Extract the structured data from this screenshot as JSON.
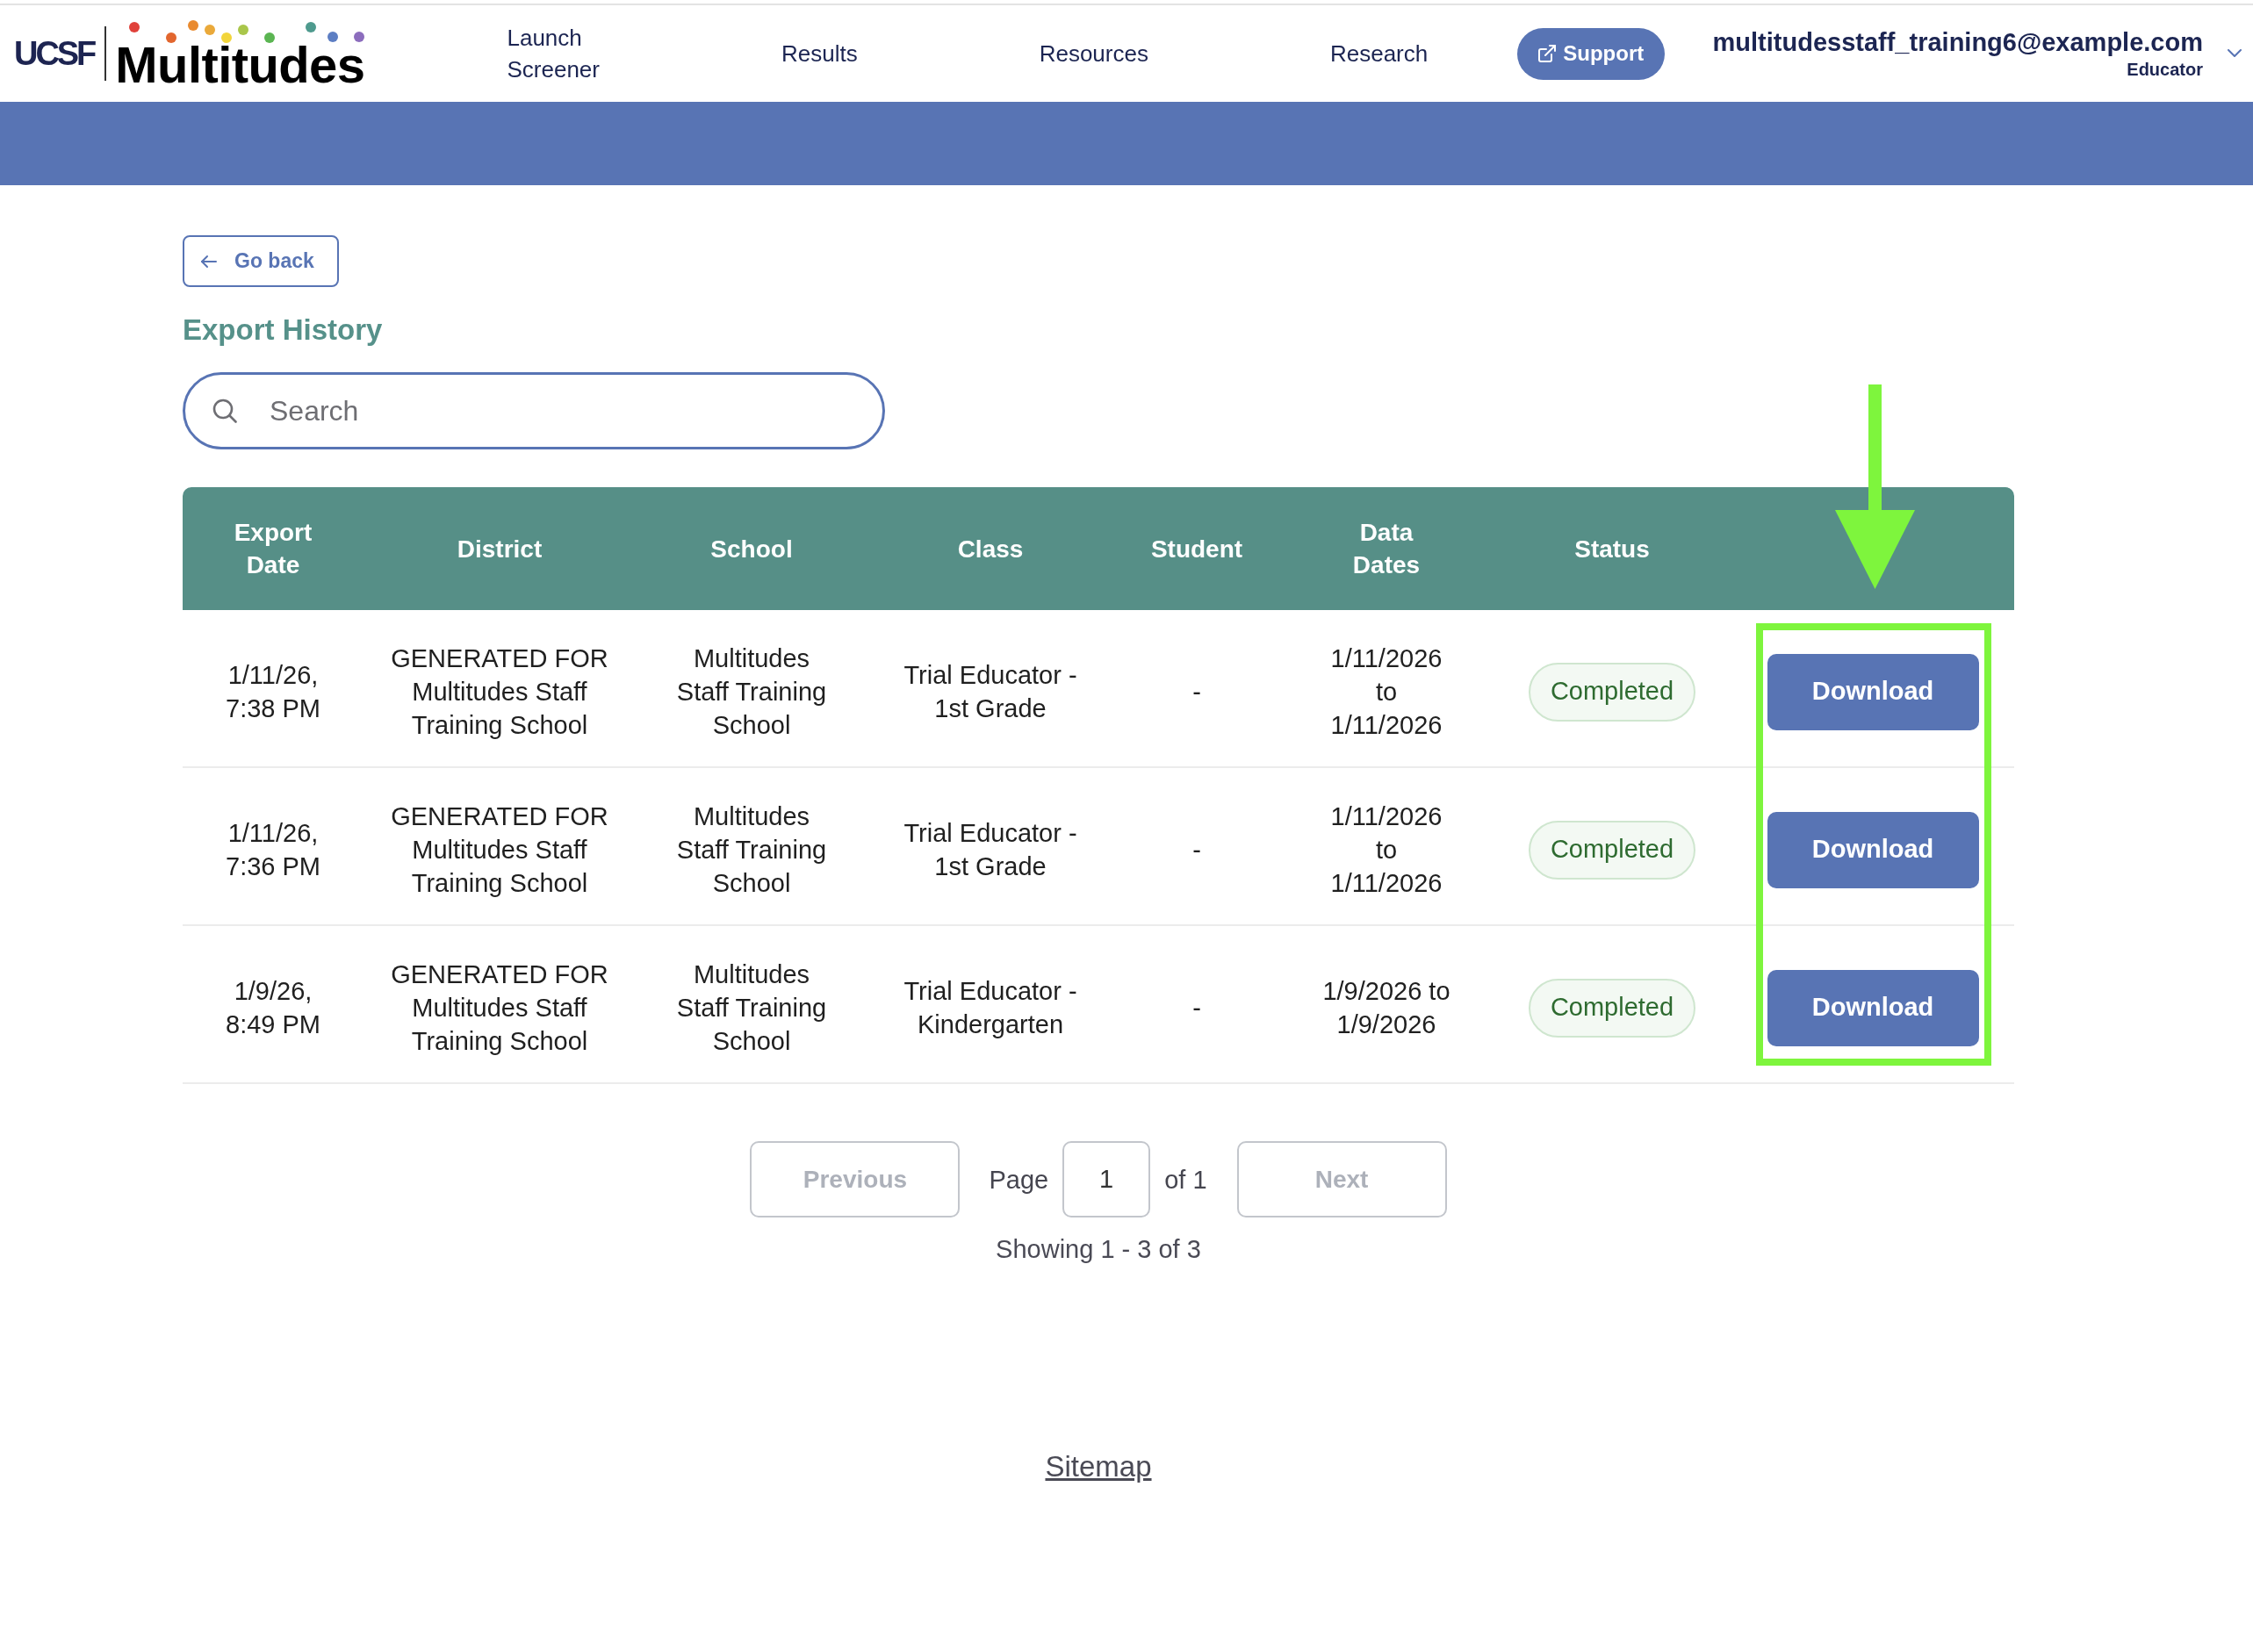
{
  "header": {
    "logo": {
      "org": "UCSF",
      "name": "Multitudes"
    },
    "nav": [
      {
        "label": "Launch Screener"
      },
      {
        "label": "Results"
      },
      {
        "label": "Resources"
      },
      {
        "label": "Research"
      }
    ],
    "support_button": {
      "label": "Support"
    },
    "user": {
      "email": "multitudesstaff_training6@example.com",
      "role": "Educator"
    }
  },
  "back_button": {
    "label": "Go back"
  },
  "page_title": "Export History",
  "search": {
    "placeholder": "Search"
  },
  "table": {
    "columns": [
      "Export Date",
      "District",
      "School",
      "Class",
      "Student",
      "Data Dates",
      "Status"
    ],
    "rows": [
      {
        "export_date": "1/11/26, 7:38 PM",
        "district": "GENERATED FOR Multitudes Staff Training School",
        "school": "Multitudes Staff Training School",
        "class": "Trial Educator - 1st Grade",
        "student": "-",
        "data_dates": "1/11/2026 to 1/11/2026",
        "status": "Completed",
        "action": "Download"
      },
      {
        "export_date": "1/11/26, 7:36 PM",
        "district": "GENERATED FOR Multitudes Staff Training School",
        "school": "Multitudes Staff Training School",
        "class": "Trial Educator - 1st Grade",
        "student": "-",
        "data_dates": "1/11/2026 to 1/11/2026",
        "status": "Completed",
        "action": "Download"
      },
      {
        "export_date": "1/9/26, 8:49 PM",
        "district": "GENERATED FOR Multitudes Staff Training School",
        "school": "Multitudes Staff Training School",
        "class": "Trial Educator - Kindergarten",
        "student": "-",
        "data_dates": "1/9/2026 to 1/9/2026",
        "status": "Completed",
        "action": "Download"
      }
    ]
  },
  "pagination": {
    "previous": {
      "label": "Previous",
      "disabled": true
    },
    "page_label": "Page",
    "page_input": {
      "value": "1"
    },
    "of_label": "of 1",
    "next": {
      "label": "Next",
      "disabled": true
    },
    "summary": "Showing 1 - 3 of 3"
  },
  "footer": {
    "links": [
      {
        "label": "Sitemap"
      }
    ]
  },
  "annotations": {
    "arrow": true,
    "highlight_box": true
  }
}
